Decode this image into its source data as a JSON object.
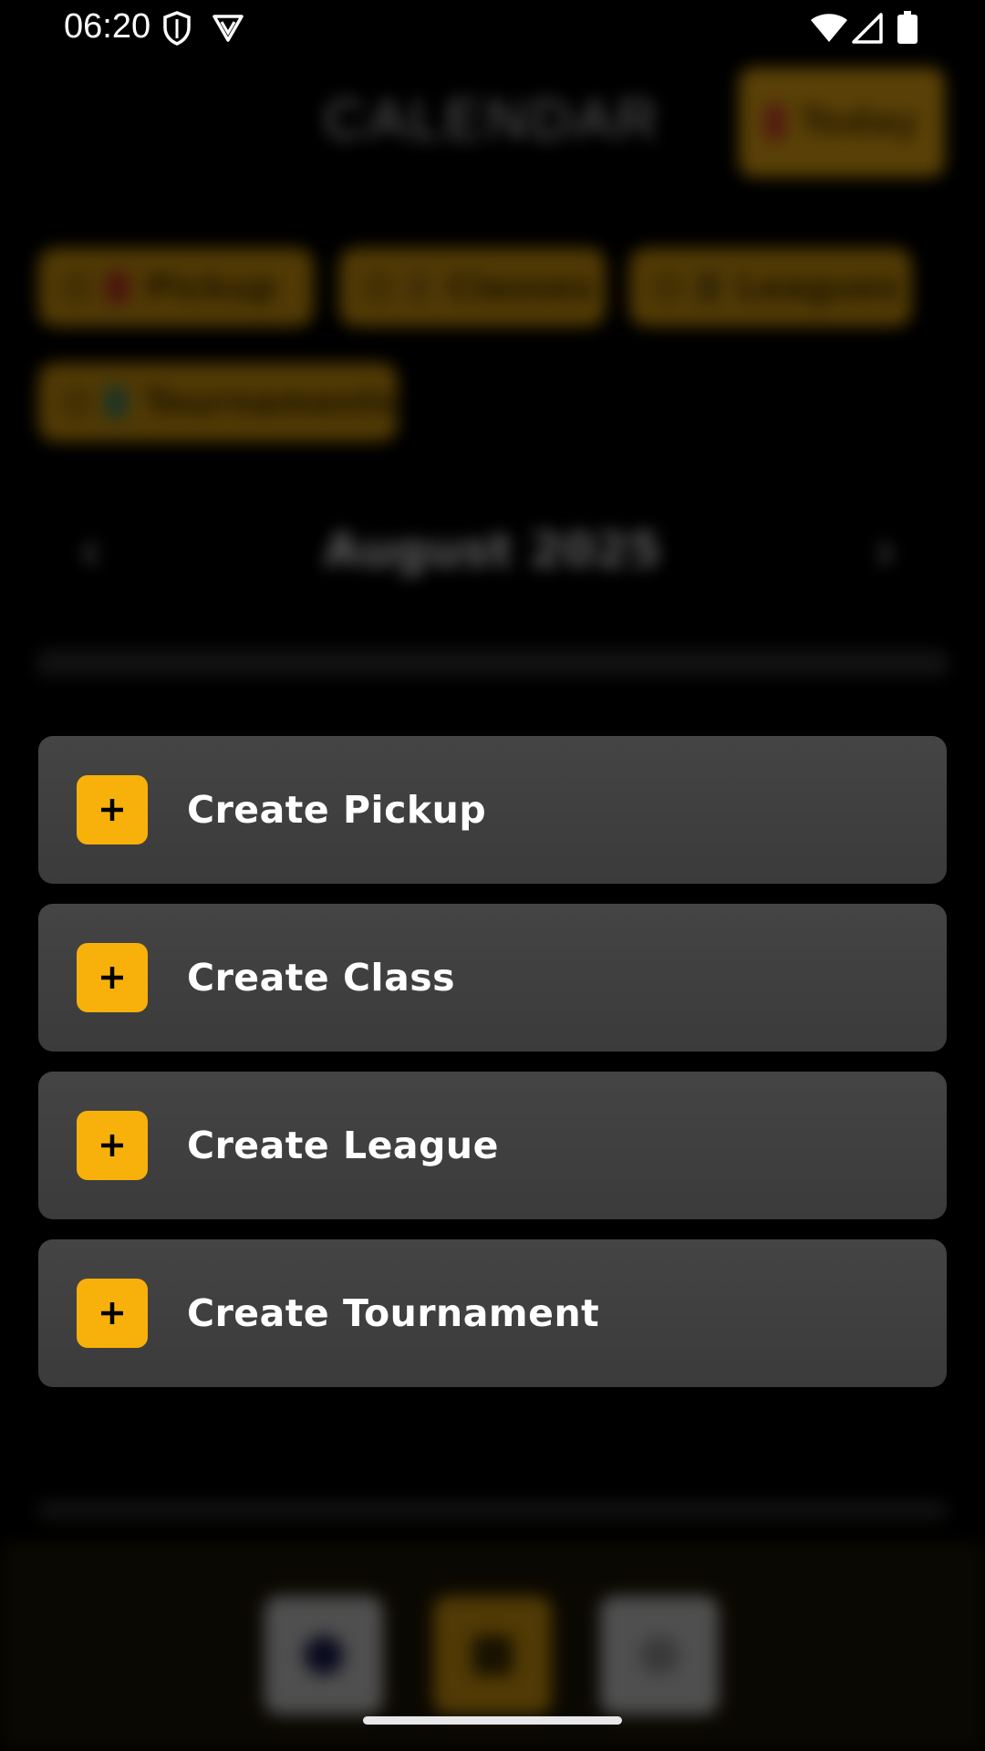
{
  "status_bar": {
    "time": "06:20",
    "left_icons": [
      "shield-icon",
      "vpn-badge-icon"
    ],
    "right_icons": [
      "wifi-icon",
      "signal-icon",
      "battery-icon"
    ]
  },
  "actions": [
    {
      "label": "Create Pickup",
      "icon": "plus-icon"
    },
    {
      "label": "Create Class",
      "icon": "plus-icon"
    },
    {
      "label": "Create League",
      "icon": "plus-icon"
    },
    {
      "label": "Create Tournament",
      "icon": "plus-icon"
    }
  ],
  "colors": {
    "accent": "#f7b10a",
    "card": "#404040",
    "background": "#000000"
  }
}
